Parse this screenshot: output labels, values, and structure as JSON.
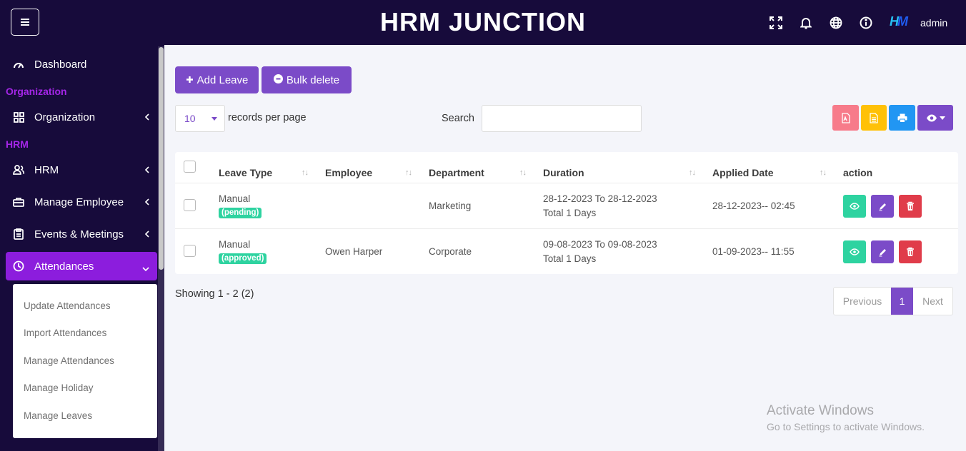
{
  "header": {
    "title": "HRM JUNCTION",
    "logo_text_a": "H",
    "logo_text_b": "M",
    "user": "admin"
  },
  "sidebar": {
    "dashboard": "Dashboard",
    "section_org": "Organization",
    "organization": "Organization",
    "section_hrm": "HRM",
    "hrm": "HRM",
    "manage_employee": "Manage Employee",
    "events": "Events & Meetings",
    "attendances": "Attendances",
    "submenu": [
      "Update Attendances",
      "Import Attendances",
      "Manage Attendances",
      "Manage Holiday",
      "Manage Leaves"
    ]
  },
  "toolbar": {
    "add_leave": "Add Leave",
    "bulk_delete": "Bulk delete",
    "per_page_value": "10",
    "per_page_label": "records per page",
    "search_label": "Search"
  },
  "table": {
    "headers": [
      "Leave Type",
      "Employee",
      "Department",
      "Duration",
      "Applied Date",
      "action"
    ],
    "rows": [
      {
        "leave_type": "Manual",
        "status": "(pending)",
        "employee": "",
        "department": "Marketing",
        "duration_range": "28-12-2023 To 28-12-2023",
        "duration_days": "Total 1 Days",
        "applied": "28-12-2023-- 02:45"
      },
      {
        "leave_type": "Manual",
        "status": "(approved)",
        "employee": "Owen Harper",
        "department": "Corporate",
        "duration_range": "09-08-2023 To 09-08-2023",
        "duration_days": "Total 1 Days",
        "applied": "01-09-2023-- 11:55"
      }
    ]
  },
  "footer": {
    "showing": "Showing 1 - 2 (2)",
    "previous": "Previous",
    "page": "1",
    "next": "Next"
  },
  "watermark": {
    "line1": "Activate Windows",
    "line2": "Go to Settings to activate Windows."
  },
  "colors": {
    "header_bg": "#170b3b",
    "accent": "#7b4bc8",
    "active_nav": "#8c1ddd",
    "pdf_btn": "#f77b8a",
    "csv_btn": "#ffc107",
    "print_btn": "#2196f3",
    "view_btn": "#2ed3a0",
    "edit_btn": "#7b4bc8",
    "delete_btn": "#e03c4a"
  }
}
